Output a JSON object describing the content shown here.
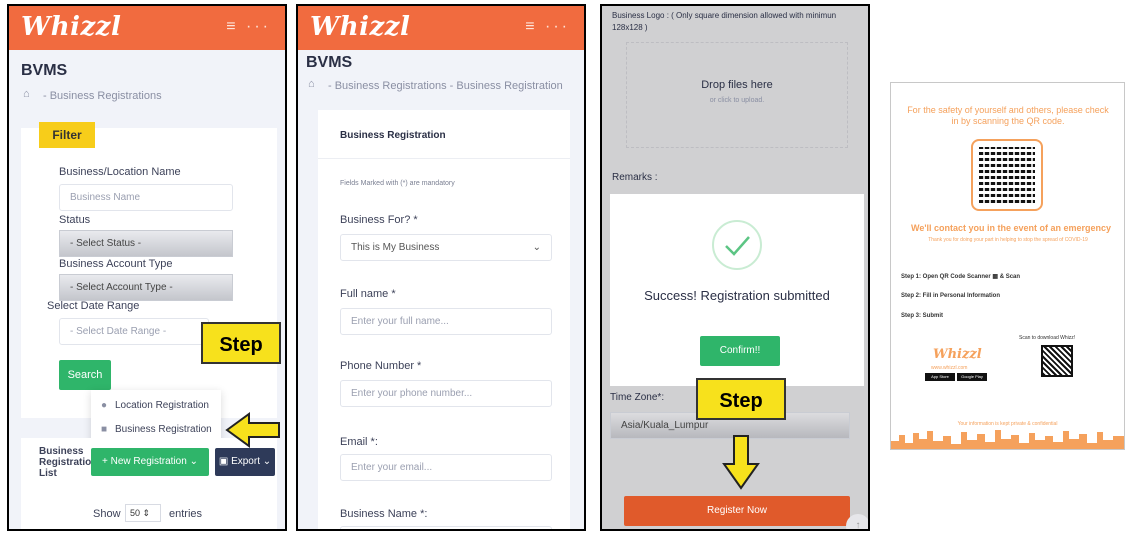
{
  "brand": {
    "logo": "Whizzl",
    "menu_icons": "≡ ···"
  },
  "panel1": {
    "page_title": "BVMS",
    "breadcrumb": "- Business Registrations",
    "filter_badge": "Filter",
    "business_label": "Business/Location Name",
    "business_placeholder": "Business Name",
    "status_label": "Status",
    "status_value": "- Select Status -",
    "account_type_label": "Business Account Type",
    "account_type_value": "- Select Account Type -",
    "date_label": "Select Date Range",
    "date_value": "- Select Date Range -",
    "search_button": "Search",
    "menu_location": "Location Registration",
    "menu_business": "Business Registration",
    "list_title": "Business Registration List",
    "new_registration": "New Registration",
    "export": "Export",
    "show": "Show",
    "show_value": "50",
    "entries": "entries"
  },
  "step_label": "Step",
  "panel2": {
    "page_title": "BVMS",
    "breadcrumb": "- Business Registrations - Business Registration",
    "form_title": "Business Registration",
    "mandatory_note": "Fields Marked with (*) are mandatory",
    "business_for_label": "Business For? *",
    "business_for_value": "This is My Business",
    "fullname_label": "Full name *",
    "fullname_placeholder": "Enter your full name...",
    "phone_label": "Phone Number *",
    "phone_placeholder": "Enter your phone number...",
    "email_label": "Email *:",
    "email_placeholder": "Enter your email...",
    "business_name_label": "Business Name *:"
  },
  "panel3": {
    "logo_label": "Business Logo : ( Only square dimension allowed with minimun 128x128 )",
    "drop_title": "Drop files here",
    "drop_sub": "or click to upload.",
    "remarks": "Remarks :",
    "success_msg": "Success! Registration submitted",
    "confirm": "Confirm!!",
    "timezone_label": "Time Zone*:",
    "timezone_value": "Asia/Kuala_Lumpur",
    "register": "Register Now"
  },
  "poster": {
    "headline": "For the safety of yourself and others, please check in by scanning the QR code.",
    "contact": "We'll contact you in the event of an emergency",
    "thanks": "Thank you for doing your part in helping to stop the spread of COVID-19",
    "step1": "Step 1: Open QR Code Scanner",
    "step1_scan": "& Scan",
    "step2": "Step 2: Fill in Personal Information",
    "step3": "Step 3: Submit",
    "download": "Scan to download Whizz!",
    "site": "www.whizzl.com",
    "appstore": "App Store",
    "googleplay": "Google Play",
    "privacy": "Your information is kept private & confidential"
  },
  "colors": {
    "brand": "#f16b3f",
    "green": "#2fb56a",
    "navy": "#2e3a59",
    "callout": "#f7e11c"
  }
}
